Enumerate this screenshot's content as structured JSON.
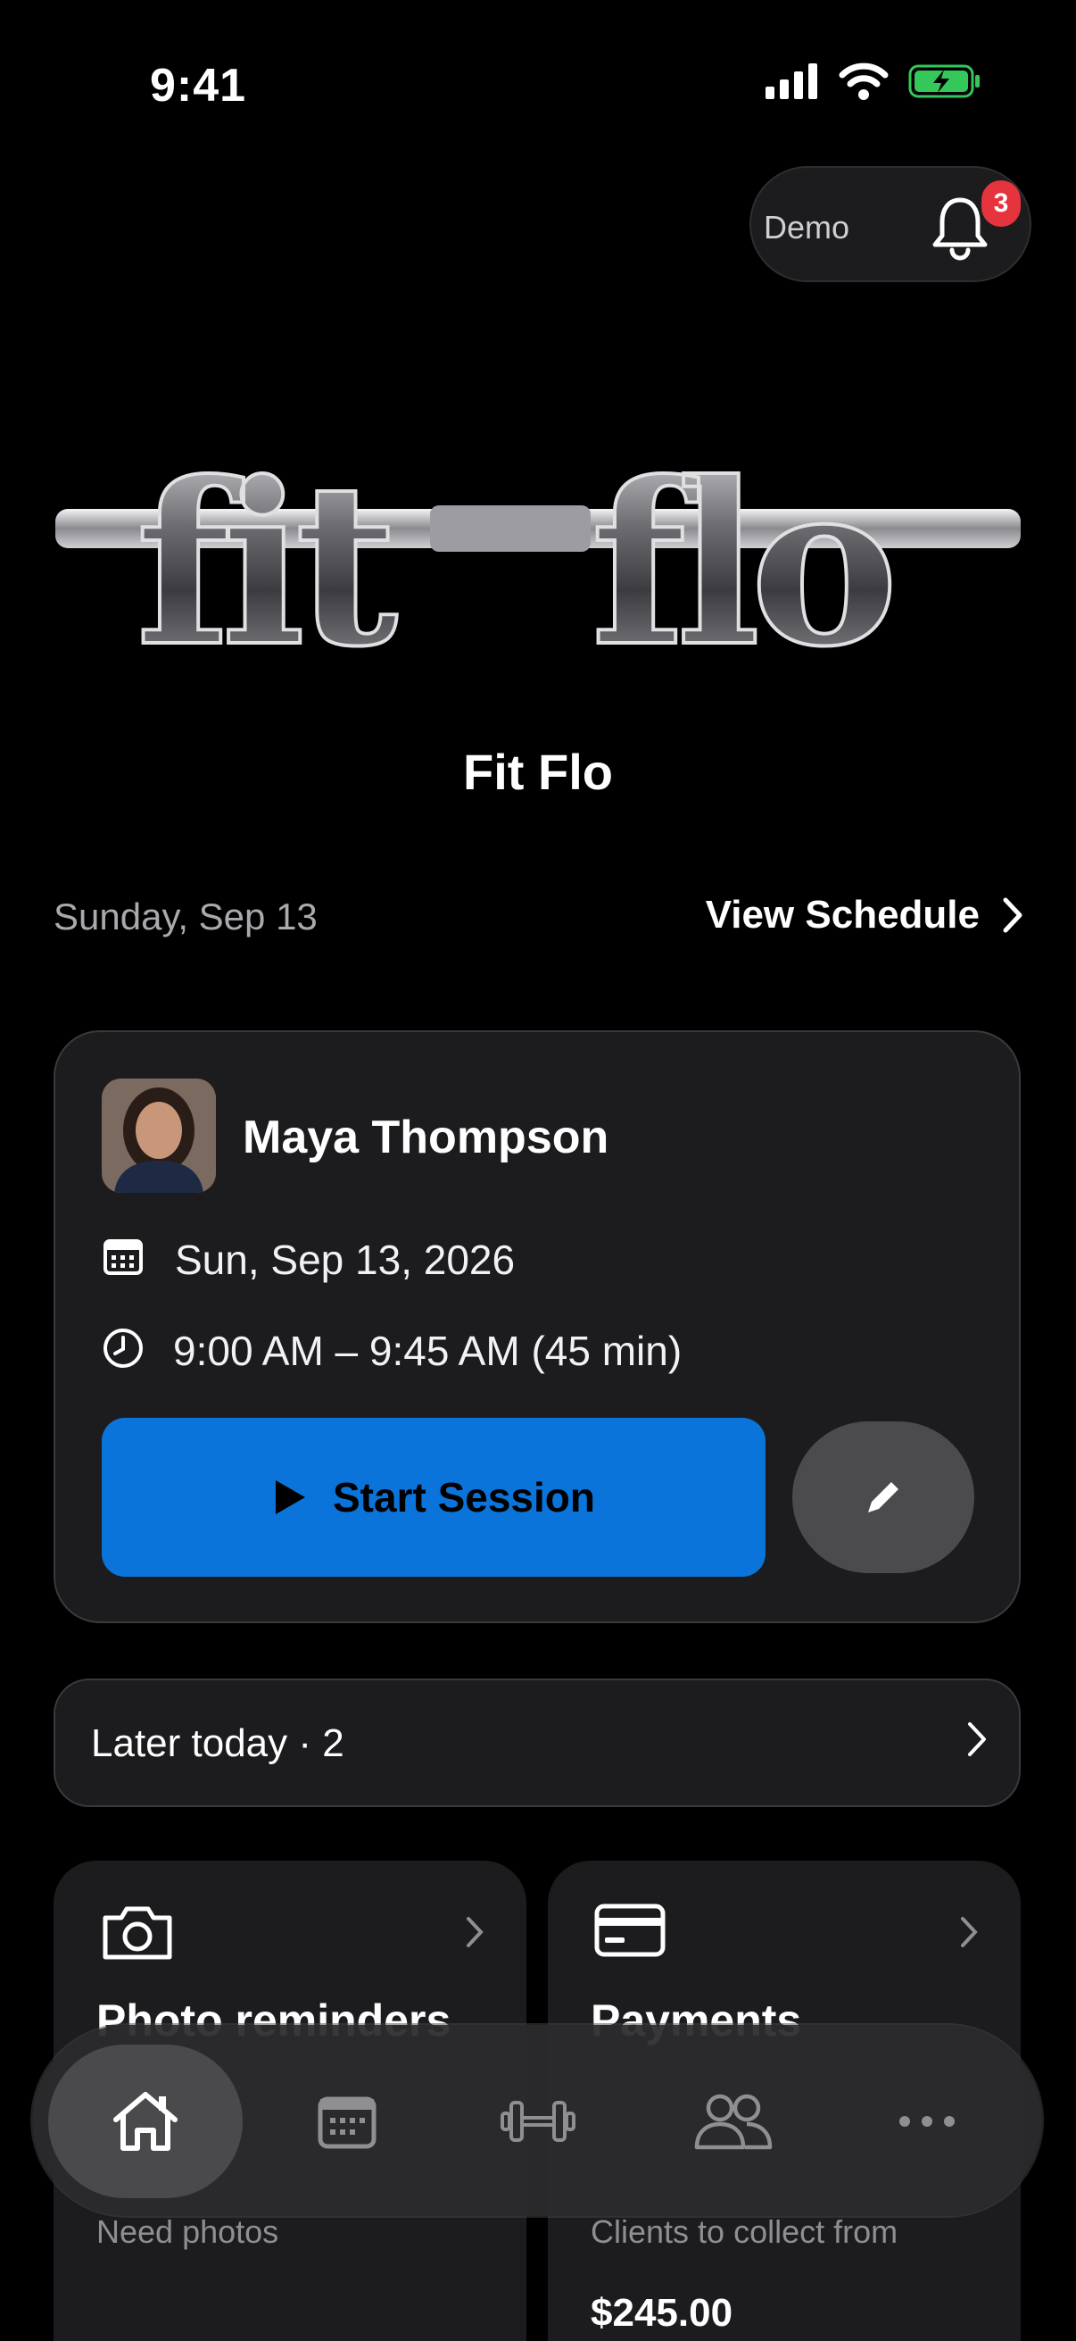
{
  "status_bar": {
    "time": "9:41"
  },
  "header": {
    "demo_label": "Demo",
    "notification_count": "3"
  },
  "app": {
    "name": "Fit Flo",
    "logo_text": "fit flo"
  },
  "schedule": {
    "date": "Sunday, Sep 13",
    "view_schedule_label": "View Schedule"
  },
  "session": {
    "client_name": "Maya Thompson",
    "date": "Sun, Sep 13, 2026",
    "time": "9:00 AM – 9:45 AM (45 min)",
    "start_label": "Start Session"
  },
  "later_today": {
    "label": "Later today · 2"
  },
  "cards": [
    {
      "title": "Photo reminders",
      "subtitle": "Need photos",
      "icon": "camera-icon"
    },
    {
      "title": "Payments",
      "subtitle": "Clients to collect from",
      "amount": "$245.00",
      "icon": "credit-card-icon"
    }
  ],
  "tabs": [
    {
      "name": "home",
      "icon": "home-icon",
      "active": true
    },
    {
      "name": "calendar",
      "icon": "calendar-icon",
      "active": false
    },
    {
      "name": "workouts",
      "icon": "dumbbell-icon",
      "active": false
    },
    {
      "name": "clients",
      "icon": "people-icon",
      "active": false
    },
    {
      "name": "more",
      "icon": "more-icon",
      "active": false
    }
  ],
  "colors": {
    "accent": "#0a74da",
    "badge": "#e5343d",
    "battery": "#34c759"
  }
}
